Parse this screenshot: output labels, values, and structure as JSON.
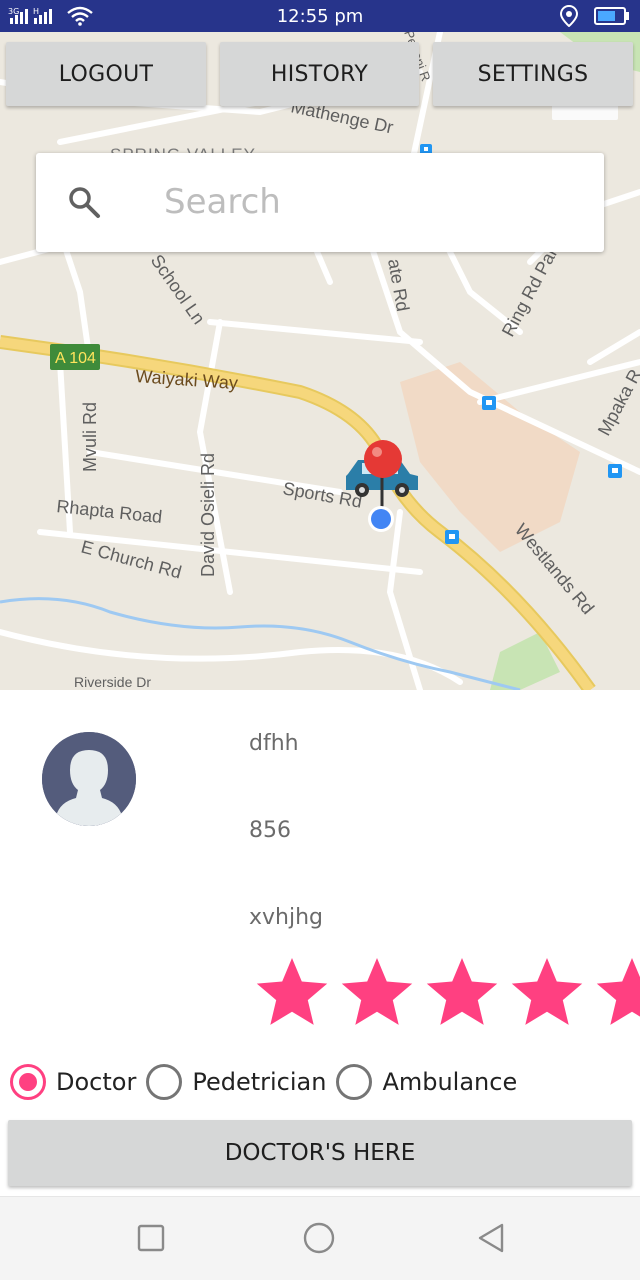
{
  "status_bar": {
    "time": "12:55 pm",
    "signal_label": "3G",
    "signal2_label": "H",
    "icons": [
      "signal-icon",
      "wifi-icon",
      "location-icon",
      "battery-icon"
    ]
  },
  "top_buttons": {
    "logout": "LOGOUT",
    "history": "HISTORY",
    "settings": "SETTINGS"
  },
  "search": {
    "placeholder": "Search"
  },
  "map": {
    "labels": {
      "spring_valley": "SPRING VALLEY",
      "mathenge": "Mathenge Dr",
      "school_ln": "School Ln",
      "a104": "A 104",
      "waiyaki": "Waiyaki Way",
      "ring_rd": "Ring Rd Park",
      "mpaka": "Mpaka R",
      "mvuli": "Mvuli Rd",
      "david_osieli": "David Osieli Rd",
      "sports_rd": "Sports Rd",
      "rhapta": "Rhapta Road",
      "e_church": "E Church Rd",
      "westlands": "Westlands Rd",
      "riverside": "Riverside Dr",
      "ate_rd": "ate Rd",
      "perani": "Peponi R"
    }
  },
  "profile": {
    "name": "dfhh",
    "number": "856",
    "detail": "xvhjhg",
    "rating": 5,
    "rating_max": 5
  },
  "roles": {
    "options": [
      "Doctor",
      "Pedetrician",
      "Ambulance"
    ],
    "selected": "Doctor"
  },
  "action": {
    "label": "DOCTOR'S HERE"
  },
  "colors": {
    "status_bar": "#27348b",
    "accent": "#ff4081",
    "button_bg": "#d6d7d7",
    "map_bg": "#ece8df",
    "road_major": "#f6d77c",
    "marker_red": "#e53935",
    "location_blue": "#4285f4"
  }
}
